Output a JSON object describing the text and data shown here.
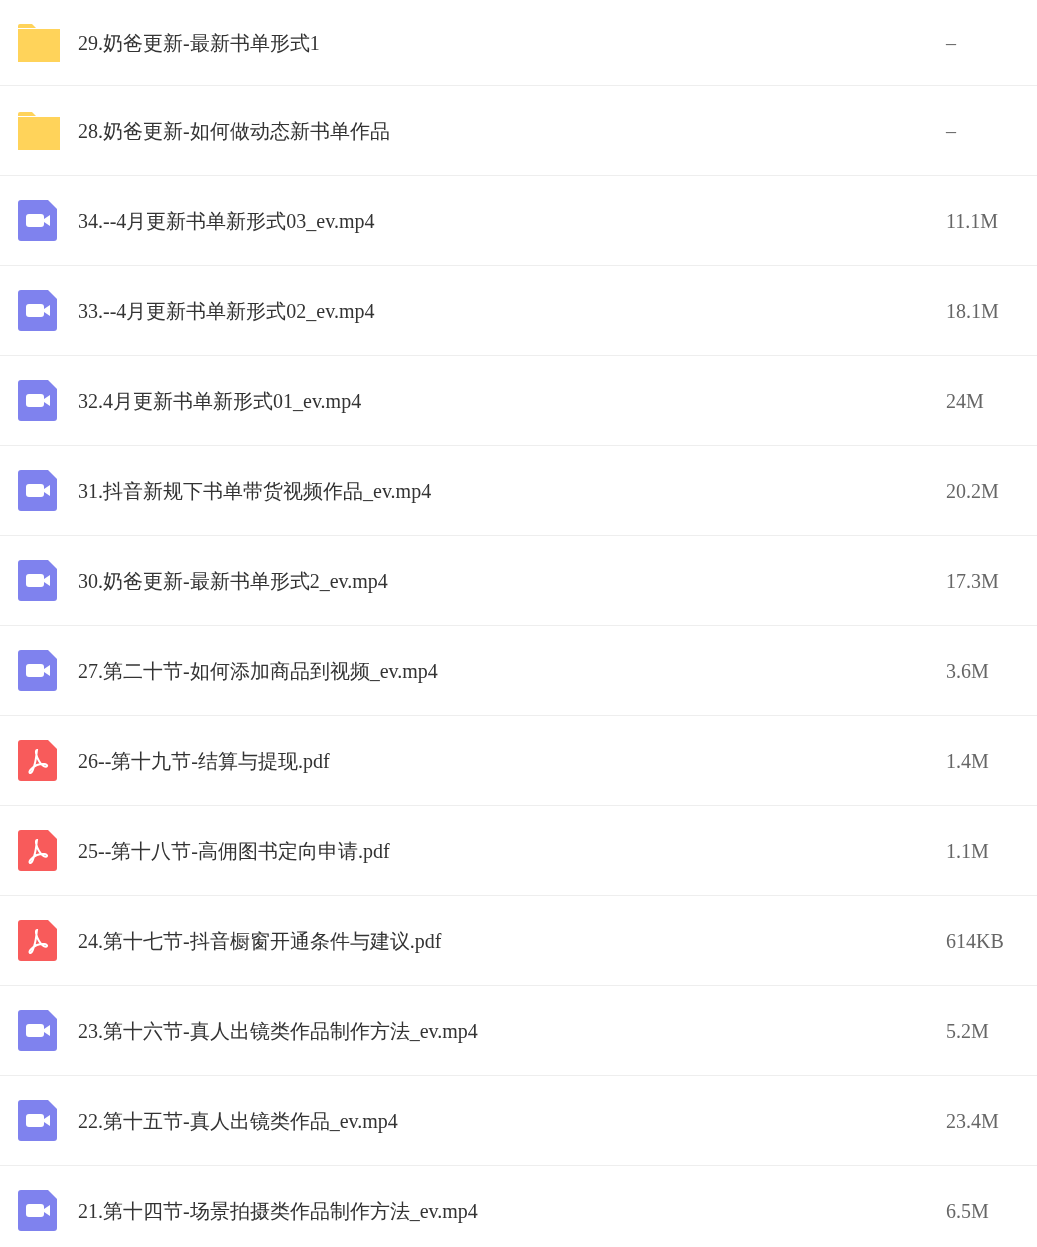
{
  "files": [
    {
      "kind": "folder",
      "name": "29.奶爸更新-最新书单形式1",
      "size": "–"
    },
    {
      "kind": "folder",
      "name": "28.奶爸更新-如何做动态新书单作品",
      "size": "–"
    },
    {
      "kind": "video",
      "name": "34.--4月更新书单新形式03_ev.mp4",
      "size": "11.1M"
    },
    {
      "kind": "video",
      "name": "33.--4月更新书单新形式02_ev.mp4",
      "size": "18.1M"
    },
    {
      "kind": "video",
      "name": "32.4月更新书单新形式01_ev.mp4",
      "size": "24M"
    },
    {
      "kind": "video",
      "name": "31.抖音新规下书单带货视频作品_ev.mp4",
      "size": "20.2M"
    },
    {
      "kind": "video",
      "name": "30.奶爸更新-最新书单形式2_ev.mp4",
      "size": "17.3M"
    },
    {
      "kind": "video",
      "name": "27.第二十节-如何添加商品到视频_ev.mp4",
      "size": "3.6M"
    },
    {
      "kind": "pdf",
      "name": "26--第十九节-结算与提现.pdf",
      "size": "1.4M"
    },
    {
      "kind": "pdf",
      "name": "25--第十八节-高佣图书定向申请.pdf",
      "size": "1.1M"
    },
    {
      "kind": "pdf",
      "name": "24.第十七节-抖音橱窗开通条件与建议.pdf",
      "size": "614KB"
    },
    {
      "kind": "video",
      "name": "23.第十六节-真人出镜类作品制作方法_ev.mp4",
      "size": "5.2M"
    },
    {
      "kind": "video",
      "name": "22.第十五节-真人出镜类作品_ev.mp4",
      "size": "23.4M"
    },
    {
      "kind": "video",
      "name": "21.第十四节-场景拍摄类作品制作方法_ev.mp4",
      "size": "6.5M"
    }
  ]
}
